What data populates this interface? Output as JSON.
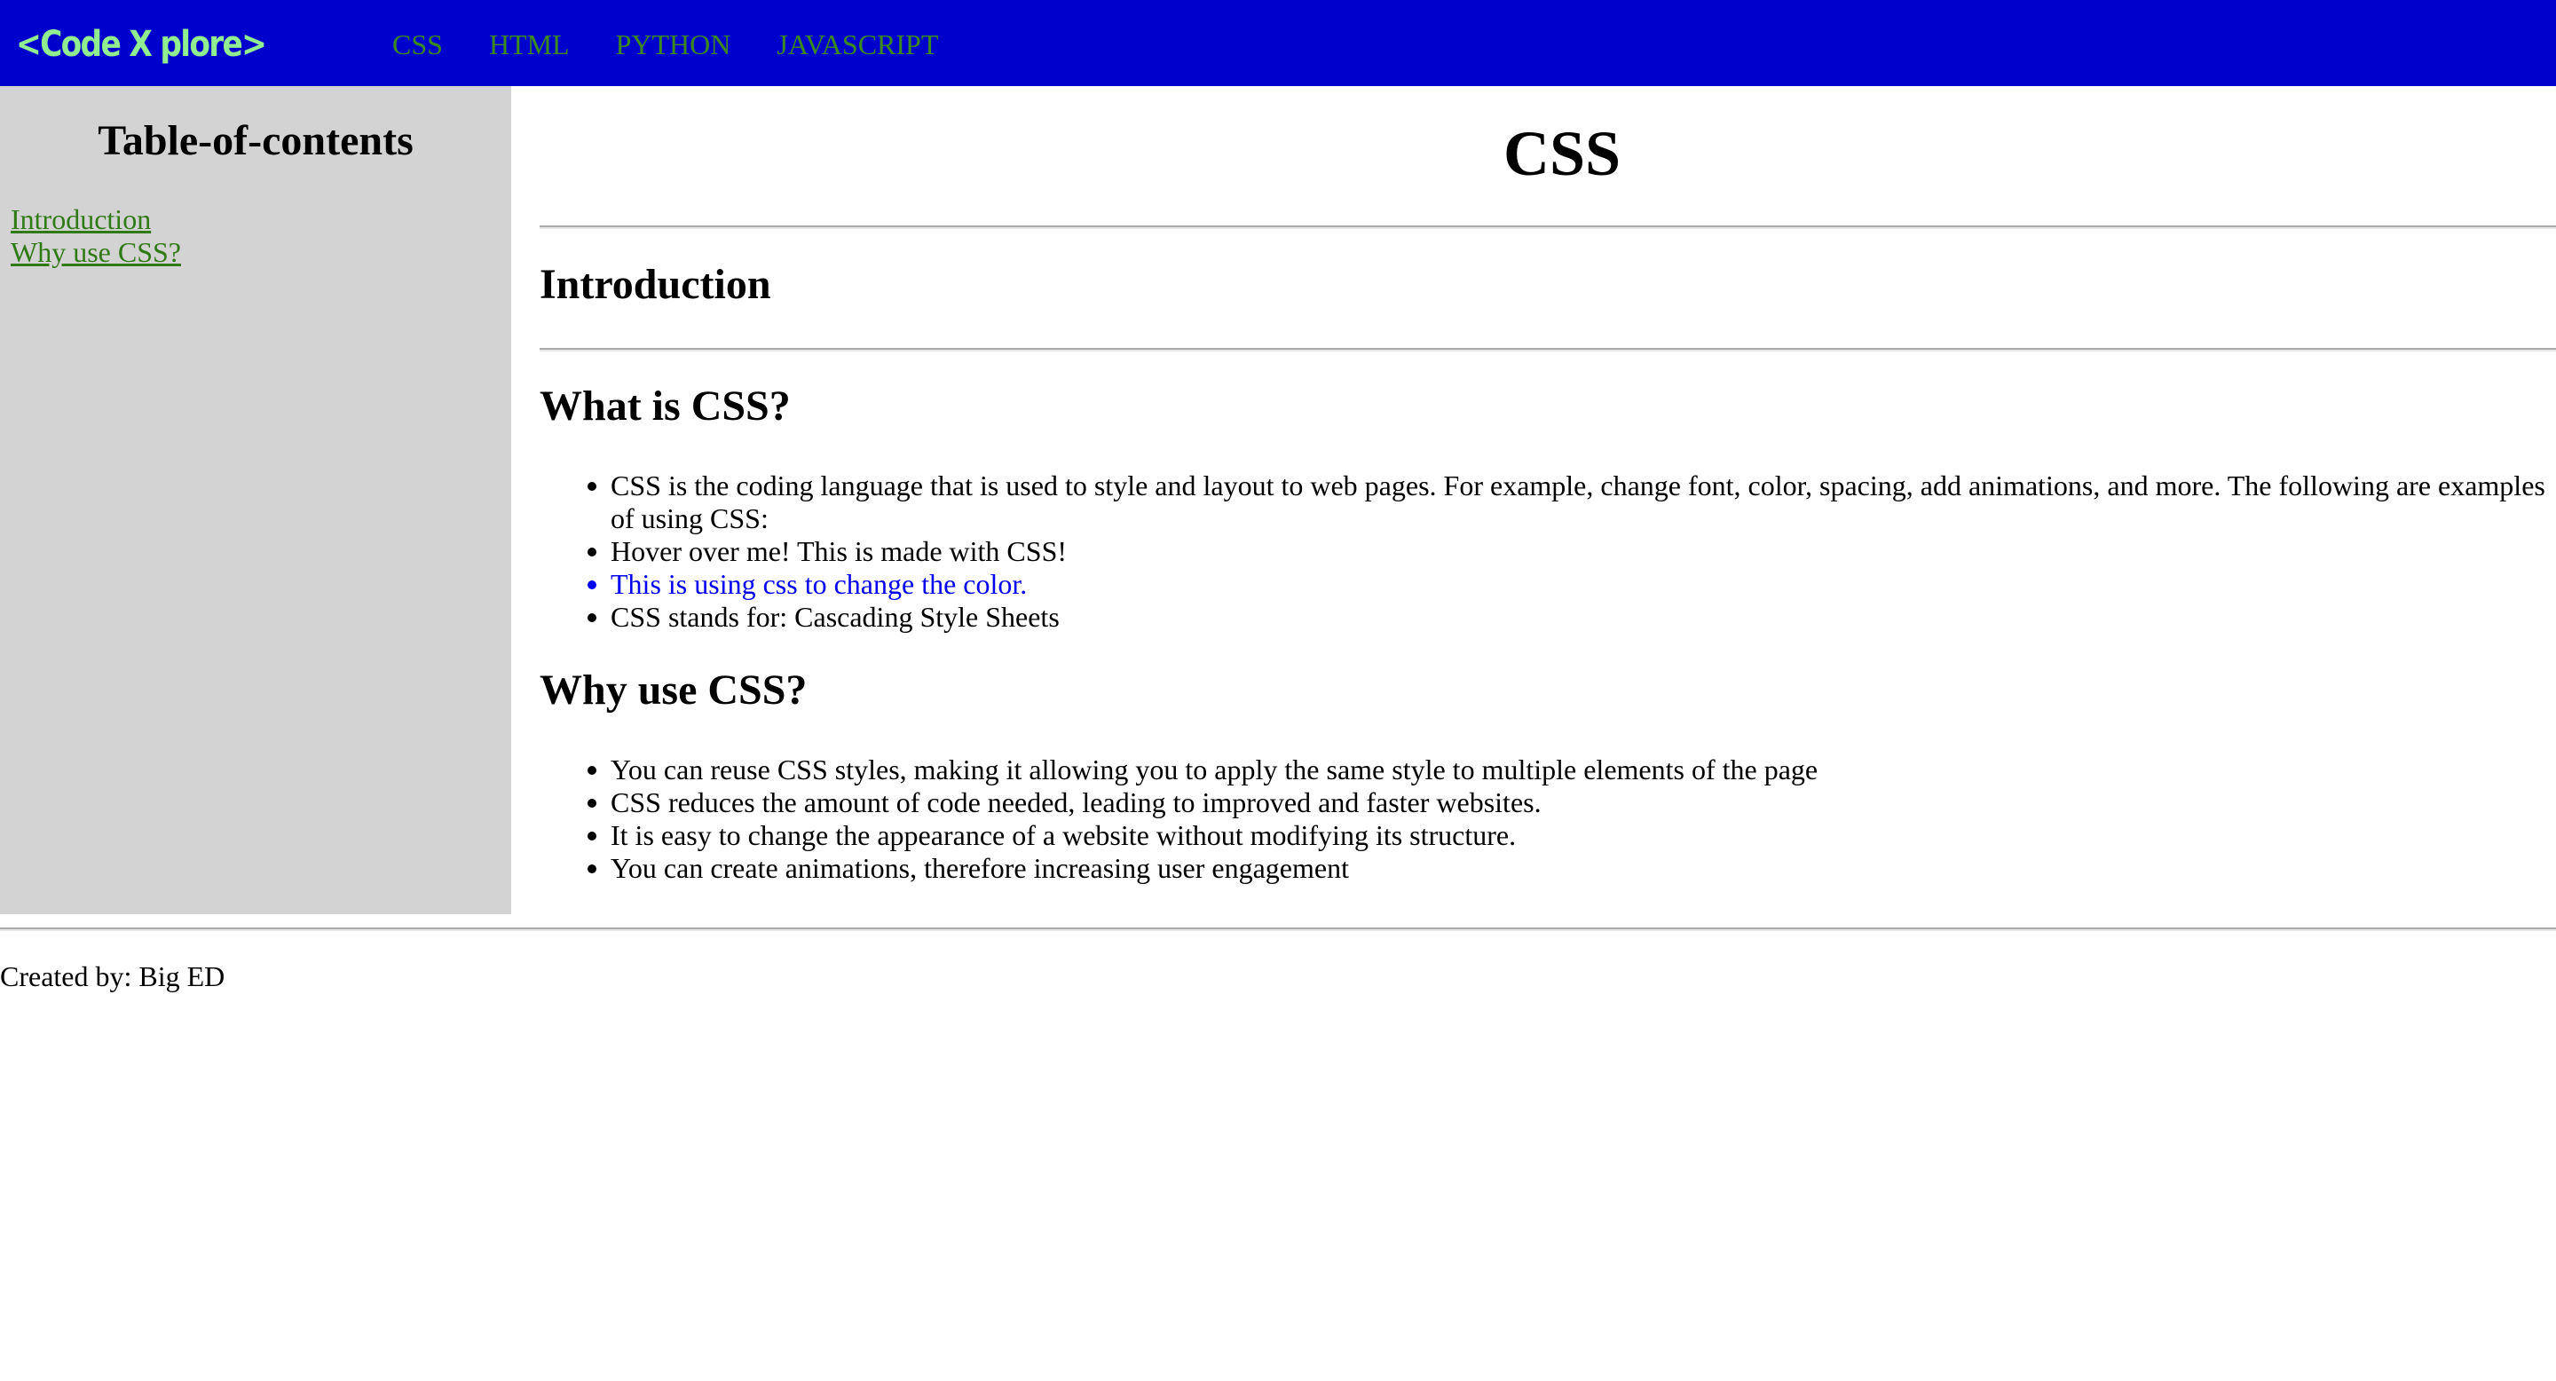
{
  "header": {
    "logo": "<Code X plore>",
    "nav": [
      "CSS",
      "HTML",
      "PYTHON",
      "JAVASCRIPT"
    ]
  },
  "sidebar": {
    "title": "Table-of-contents",
    "links": [
      "Introduction",
      "Why use CSS?"
    ]
  },
  "main": {
    "title": "CSS",
    "intro_heading": "Introduction",
    "what_heading": "What is CSS?",
    "what_items": [
      "CSS is the coding language that is used to style and layout to web pages. For example, change font, color, spacing, add animations, and more. The following are examples of using CSS:",
      "Hover over me! This is made with CSS!",
      "This is using css to change the color.",
      "CSS stands for: Cascading Style Sheets"
    ],
    "why_heading": "Why use CSS?",
    "why_items": [
      "You can reuse CSS styles, making it allowing you to apply the same style to multiple elements of the page",
      "CSS reduces the amount of code needed, leading to improved and faster websites.",
      "It is easy to change the appearance of a website without modifying its structure.",
      "You can create animations, therefore increasing user engagement"
    ]
  },
  "footer": {
    "credit": "Created by: Big ED"
  },
  "colors": {
    "header_bg": "#0000cc",
    "logo": "#90ee90",
    "nav_link": "#3b8a1f",
    "sidebar_bg": "#d3d3d3",
    "toc_link": "#2f7a14",
    "blue_text": "#0000ee"
  }
}
